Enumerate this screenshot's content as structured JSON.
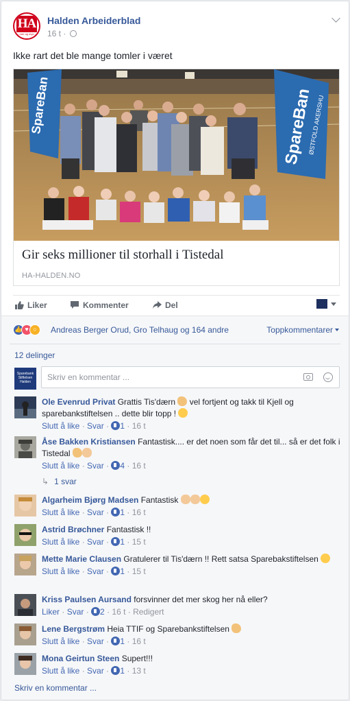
{
  "post": {
    "page_name": "Halden Arbeiderblad",
    "logo_text": "HA",
    "logo_tagline": "— mer og mye —",
    "time": "16 t",
    "separator": "·",
    "text": "Ikke rart det ble mange tomler i været",
    "link": {
      "title": "Gir seks millioner til storhall i Tistedal",
      "domain": "HA-HALDEN.NO",
      "banner_text": "SpareBan",
      "banner_sub": "ØSTFOLD AKERSHU"
    }
  },
  "actions": {
    "like": "Liker",
    "comment": "Kommenter",
    "share": "Del"
  },
  "reactions": {
    "summary": "Andreas Berger Orud, Gro Telhaug og 164 andre",
    "sort_label": "Toppkommentarer",
    "shares": "12 delinger",
    "icons": [
      "like-icon",
      "love-icon",
      "wow-icon"
    ]
  },
  "composer": {
    "placeholder": "Skriv en kommentar ...",
    "avatar_text": "Sparebank Stiftelsen Halden"
  },
  "comments": [
    {
      "name": "Ole Evenrud Privat",
      "text": "Grattis Tis'dærn",
      "text2": "vel fortjent og takk til Kjell og sparebankstiftelsen .. dette blir topp !",
      "like": "Slutt å like",
      "reply": "Svar",
      "likes": "1",
      "time": "16 t"
    },
    {
      "name": "Åse Bakken Kristiansen",
      "text": "Fantastisk.... er det noen som får det til... så er det folk i Tistedal",
      "like": "Slutt å like",
      "reply": "Svar",
      "likes": "4",
      "time": "16 t"
    },
    {
      "name": "Algarheim Bjørg Madsen",
      "text": "Fantastisk",
      "like": "Slutt å like",
      "reply": "Svar",
      "likes": "1",
      "time": "16 t"
    },
    {
      "name": "Astrid Brøchner",
      "text": "Fantastisk !!",
      "like": "Slutt å like",
      "reply": "Svar",
      "likes": "1",
      "time": "15 t"
    },
    {
      "name": "Mette Marie Clausen",
      "text": "Gratulerer til Tis'dærn !! Rett satsa Sparebakstiftelsen",
      "like": "Slutt å like",
      "reply": "Svar",
      "likes": "1",
      "time": "15 t"
    },
    {
      "name": "Kriss Paulsen Aursand",
      "text": "forsvinner det mer skog her nå eller?",
      "like": "Liker",
      "reply": "Svar",
      "likes": "2",
      "time": "16 t",
      "edited": "Redigert"
    },
    {
      "name": "Lene Bergstrøm",
      "text": "Heia TTIF og Sparebankstiftelsen",
      "like": "Slutt å like",
      "reply": "Svar",
      "likes": "1",
      "time": "16 t"
    },
    {
      "name": "Mona Geirtun Steen",
      "text": "Supert!!!",
      "like": "Slutt å like",
      "reply": "Svar",
      "likes": "1",
      "time": "13 t"
    }
  ],
  "replies_link": "1 svar",
  "write_comment": "Skriv en kommentar ...",
  "colors": {
    "link_blue": "#365899",
    "like_blue": "#4267b2",
    "brand_red": "#d0021b"
  }
}
